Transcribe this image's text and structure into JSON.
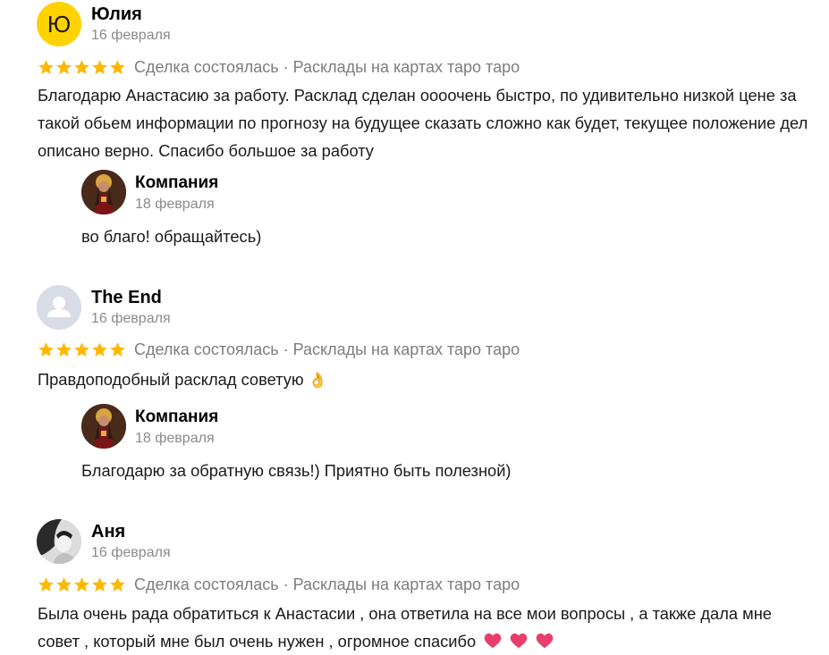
{
  "reviews": [
    {
      "author": "Юлия",
      "avatar_letter": "Ю",
      "date": "16 февраля",
      "meta": "Сделка состоялась · Расклады на картах таро таро",
      "rating": 5,
      "text": "Благодарю Анастасию за работу. Расклад сделан оооочень быстро, по удивительно низкой цене за такой обьем информации по прогнозу на будущее сказать сложно как будет, текущее положение дел описано верно. Спасибо большое за работу",
      "reply": {
        "author": "Компания",
        "date": "18 февраля",
        "text": "во благо! обращайтесь)"
      }
    },
    {
      "author": "The End",
      "date": "16 февраля",
      "meta": "Сделка состоялась · Расклады на картах таро таро",
      "rating": 5,
      "text": "Правдоподобный расклад советую",
      "text_emoji": "👌",
      "reply": {
        "author": "Компания",
        "date": "18 февраля",
        "text": "Благодарю за обратную связь!) Приятно быть полезной)"
      }
    },
    {
      "author": "Аня",
      "date": "16 февраля",
      "meta": "Сделка состоялась · Расклады на картах таро таро",
      "rating": 5,
      "text": "Была очень рада обратиться к Анастасии , она ответила на все мои вопросы , а также дала мне совет , который мне был очень нужен , огромное спасибо"
    }
  ],
  "colors": {
    "star": "#ffb800",
    "letter_avatar": "#ffd200",
    "meta_text": "#7d7d7d",
    "heart": "#e83e6c"
  }
}
